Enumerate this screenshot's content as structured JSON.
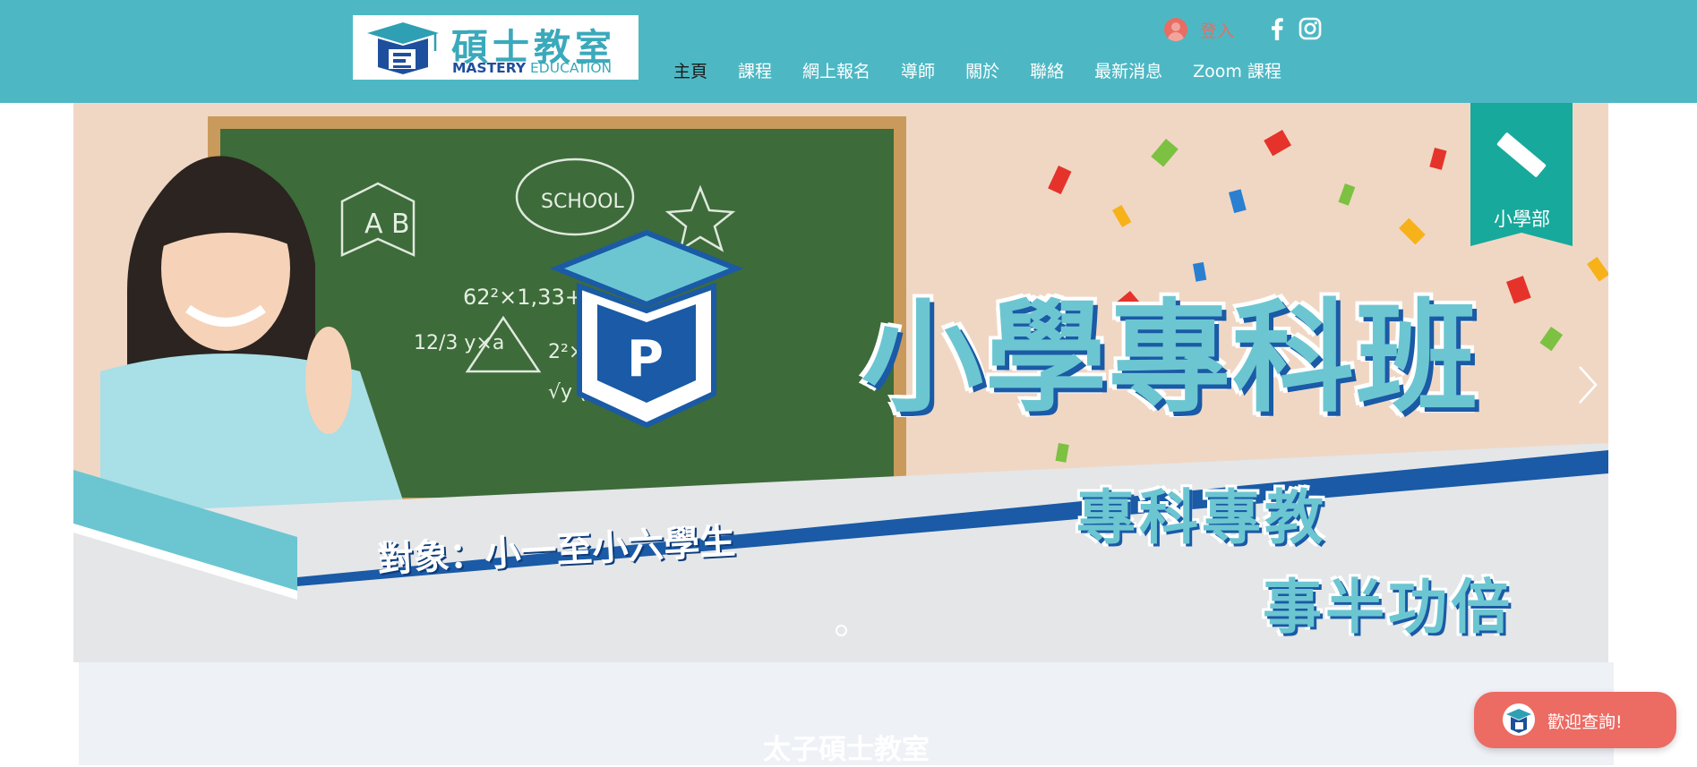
{
  "header": {
    "logo": {
      "chinese": "碩士教室",
      "english_strong": "MASTERY",
      "english_light": " EDUCATION"
    },
    "login_label": "登入",
    "social": [
      "facebook-icon",
      "instagram-icon"
    ],
    "nav": [
      {
        "label": "主頁",
        "active": true
      },
      {
        "label": "課程"
      },
      {
        "label": "網上報名"
      },
      {
        "label": "導師"
      },
      {
        "label": "關於"
      },
      {
        "label": "聯絡"
      },
      {
        "label": "最新消息"
      },
      {
        "label": "Zoom 課程"
      }
    ]
  },
  "hero": {
    "title": "小學專科班",
    "subtitle_1": "專科專教",
    "subtitle_2": "事半功倍",
    "target": "對象：小一至小六學生",
    "tag": "小學部",
    "slide_count": 1,
    "chalkboard": {
      "book_letters": "A  B",
      "cloud_word": "SCHOOL",
      "equations": [
        "62²×1,33+",
        "12/3 y×a",
        "2²×1,33+√y",
        "√y (a+l+x)"
      ],
      "cap_letter": "P"
    }
  },
  "section": {
    "title": "太子碩士教室"
  },
  "chat": {
    "label": "歡迎查詢!"
  },
  "colors": {
    "header_bg": "#4db8c4",
    "accent_coral": "#ec6b63",
    "brand_blue": "#1e4f9c",
    "brand_teal": "#3aa9bb"
  }
}
